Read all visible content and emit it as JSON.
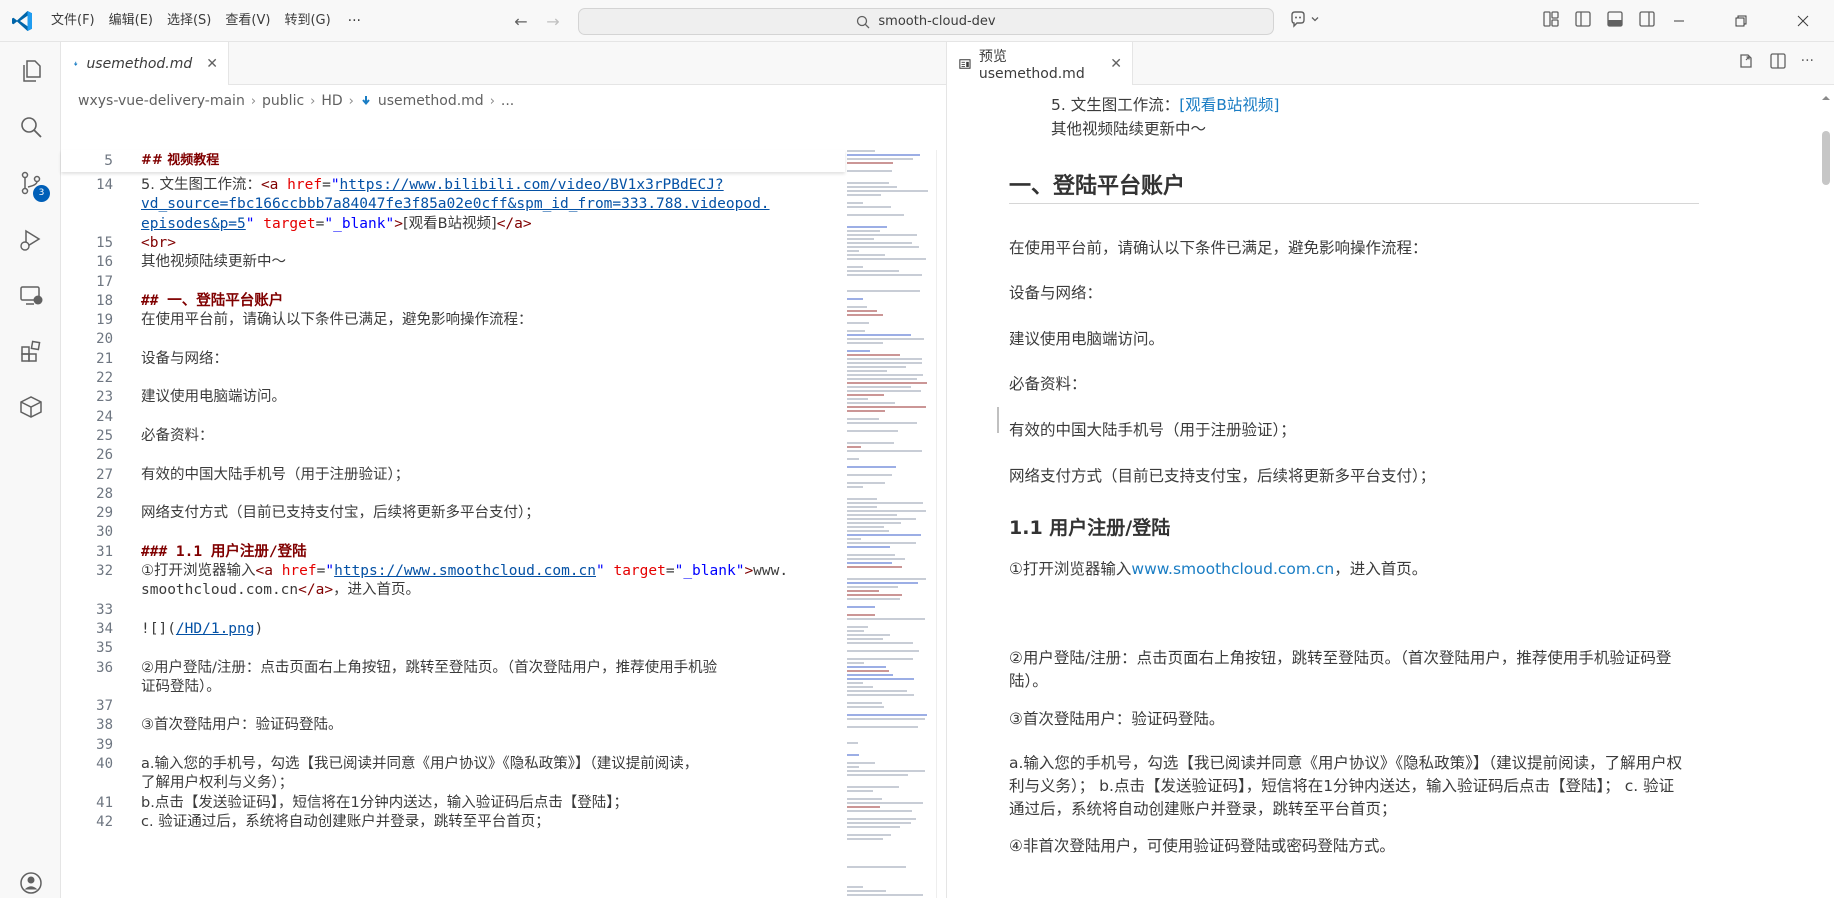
{
  "titlebar": {
    "menu": [
      "文件(F)",
      "编辑(E)",
      "选择(S)",
      "查看(V)",
      "转到(G)"
    ],
    "more": "···",
    "search": "smooth-cloud-dev"
  },
  "activitybar": {
    "scm_badge": "3"
  },
  "editor": {
    "tab_label": "usemethod.md",
    "breadcrumb": [
      "wxys-vue-delivery-main",
      "public",
      "HD",
      "usemethod.md",
      "..."
    ],
    "sticky": {
      "ln": "5",
      "text": "## 视频教程"
    },
    "lines": [
      {
        "ln": "14",
        "parts": [
          {
            "t": "5. 文生图工作流：",
            "c": "cjk"
          },
          {
            "t": "<a ",
            "c": "tag"
          },
          {
            "t": "href",
            "c": "attr"
          },
          {
            "t": "=",
            "c": ""
          },
          {
            "t": "\"",
            "c": "str"
          },
          {
            "t": "https://www.bilibili.com/video/BV1x3rPBdECJ?",
            "c": "url"
          }
        ]
      },
      {
        "ln": "",
        "parts": [
          {
            "t": "vd_source=fbc166ccbbb7a84047fe3f85a02e0cff&spm_id_from=333.788.videopod.",
            "c": "url"
          }
        ]
      },
      {
        "ln": "",
        "parts": [
          {
            "t": "episodes&p=5",
            "c": "url"
          },
          {
            "t": "\" ",
            "c": "str"
          },
          {
            "t": "target",
            "c": "attr"
          },
          {
            "t": "=",
            "c": ""
          },
          {
            "t": "\"_blank\"",
            "c": "str"
          },
          {
            "t": ">",
            "c": "tag"
          },
          {
            "t": "[观看B站视频]",
            "c": "cjk"
          },
          {
            "t": "</a>",
            "c": "tag"
          }
        ]
      },
      {
        "ln": "15",
        "parts": [
          {
            "t": "<br>",
            "c": "tag"
          }
        ]
      },
      {
        "ln": "16",
        "parts": [
          {
            "t": "其他视频陆续更新中～",
            "c": "cjk"
          }
        ]
      },
      {
        "ln": "17",
        "parts": []
      },
      {
        "ln": "18",
        "parts": [
          {
            "t": "## 一、登陆平台账户",
            "c": "h"
          }
        ]
      },
      {
        "ln": "19",
        "parts": [
          {
            "t": "在使用平台前，请确认以下条件已满足，避免影响操作流程：",
            "c": "cjk"
          }
        ]
      },
      {
        "ln": "20",
        "parts": []
      },
      {
        "ln": "21",
        "parts": [
          {
            "t": "设备与网络：",
            "c": "cjk"
          }
        ]
      },
      {
        "ln": "22",
        "parts": []
      },
      {
        "ln": "23",
        "parts": [
          {
            "t": "建议使用电脑端访问。",
            "c": "cjk"
          }
        ]
      },
      {
        "ln": "24",
        "parts": []
      },
      {
        "ln": "25",
        "parts": [
          {
            "t": "必备资料：",
            "c": "cjk"
          }
        ]
      },
      {
        "ln": "26",
        "parts": []
      },
      {
        "ln": "27",
        "parts": [
          {
            "t": "有效的中国大陆手机号（用于注册验证）；",
            "c": "cjk"
          }
        ]
      },
      {
        "ln": "28",
        "parts": []
      },
      {
        "ln": "29",
        "parts": [
          {
            "t": "网络支付方式（目前已支持支付宝，后续将更新多平台支付）；",
            "c": "cjk"
          }
        ]
      },
      {
        "ln": "30",
        "parts": []
      },
      {
        "ln": "31",
        "parts": [
          {
            "t": "### 1.1 用户注册/登陆",
            "c": "h"
          }
        ]
      },
      {
        "ln": "32",
        "parts": [
          {
            "t": "①打开浏览器输入",
            "c": "cjk"
          },
          {
            "t": "<a ",
            "c": "tag"
          },
          {
            "t": "href",
            "c": "attr"
          },
          {
            "t": "=",
            "c": ""
          },
          {
            "t": "\"",
            "c": "str"
          },
          {
            "t": "https://www.smoothcloud.com.cn",
            "c": "url"
          },
          {
            "t": "\" ",
            "c": "str"
          },
          {
            "t": "target",
            "c": "attr"
          },
          {
            "t": "=",
            "c": ""
          },
          {
            "t": "\"_blank\"",
            "c": "str"
          },
          {
            "t": ">",
            "c": "tag"
          },
          {
            "t": "www.",
            "c": ""
          }
        ]
      },
      {
        "ln": "",
        "parts": [
          {
            "t": "smoothcloud.com.cn",
            "c": ""
          },
          {
            "t": "</a>",
            "c": "tag"
          },
          {
            "t": "，进入首页。",
            "c": "cjk"
          }
        ]
      },
      {
        "ln": "33",
        "parts": []
      },
      {
        "ln": "34",
        "parts": [
          {
            "t": "![](",
            "c": ""
          },
          {
            "t": "/HD/1.png",
            "c": "url"
          },
          {
            "t": ")",
            "c": ""
          }
        ]
      },
      {
        "ln": "35",
        "parts": []
      },
      {
        "ln": "36",
        "parts": [
          {
            "t": "②用户登陆/注册：点击页面右上角按钮，跳转至登陆页。（首次登陆用户，推荐使用手机验",
            "c": "cjk"
          }
        ]
      },
      {
        "ln": "",
        "parts": [
          {
            "t": "证码登陆）。",
            "c": "cjk"
          }
        ]
      },
      {
        "ln": "37",
        "parts": []
      },
      {
        "ln": "38",
        "parts": [
          {
            "t": "③首次登陆用户：验证码登陆。",
            "c": "cjk"
          }
        ]
      },
      {
        "ln": "39",
        "parts": []
      },
      {
        "ln": "40",
        "parts": [
          {
            "t": "a.输入您的手机号，勾选【我已阅读并同意《用户协议》《隐私政策》】（建议提前阅读，",
            "c": "cjk"
          }
        ]
      },
      {
        "ln": "",
        "parts": [
          {
            "t": "了解用户权利与义务）；",
            "c": "cjk"
          }
        ]
      },
      {
        "ln": "41",
        "parts": [
          {
            "t": "b.点击【发送验证码】，短信将在1分钟内送达，输入验证码后点击【登陆】；",
            "c": "cjk"
          }
        ]
      },
      {
        "ln": "42",
        "parts": [
          {
            "t": "c. 验证通过后，系统将自动创建账户并登录，跳转至平台首页；",
            "c": "cjk"
          }
        ]
      }
    ]
  },
  "preview": {
    "tab_label": "预览 usemethod.md",
    "item5_prefix": "5. 文生图工作流：",
    "item5_link": "[观看B站视频]",
    "more_videos": "其他视频陆续更新中～",
    "h2": "一、登陆平台账户",
    "intro": "在使用平台前，请确认以下条件已满足，避免影响操作流程：",
    "device": "设备与网络：",
    "device_tip": "建议使用电脑端访问。",
    "materials": "必备资料：",
    "phone": "有效的中国大陆手机号（用于注册验证）；",
    "payment": "网络支付方式（目前已支持支付宝，后续将更新多平台支付）；",
    "h3": "1.1 用户注册/登陆",
    "step1_prefix": "①打开浏览器输入",
    "step1_link": "www.smoothcloud.com.cn",
    "step1_suffix": "，进入首页。",
    "step2": "②用户登陆/注册：点击页面右上角按钮，跳转至登陆页。（首次登陆用户，推荐使用手机验证码登陆）。",
    "step3": "③首次登陆用户：验证码登陆。",
    "step3_detail": "a.输入您的手机号，勾选【我已阅读并同意《用户协议》《隐私政策》】（建议提前阅读，了解用户权利与义务）； b.点击【发送验证码】，短信将在1分钟内送达，输入验证码后点击【登陆】； c. 验证通过后，系统将自动创建账户并登录，跳转至平台首页；",
    "step4": "④非首次登陆用户，可使用验证码登陆或密码登陆方式。"
  },
  "colors": {
    "accent": "#005fb8",
    "heading": "#800000",
    "link": "#1a7dc4"
  }
}
